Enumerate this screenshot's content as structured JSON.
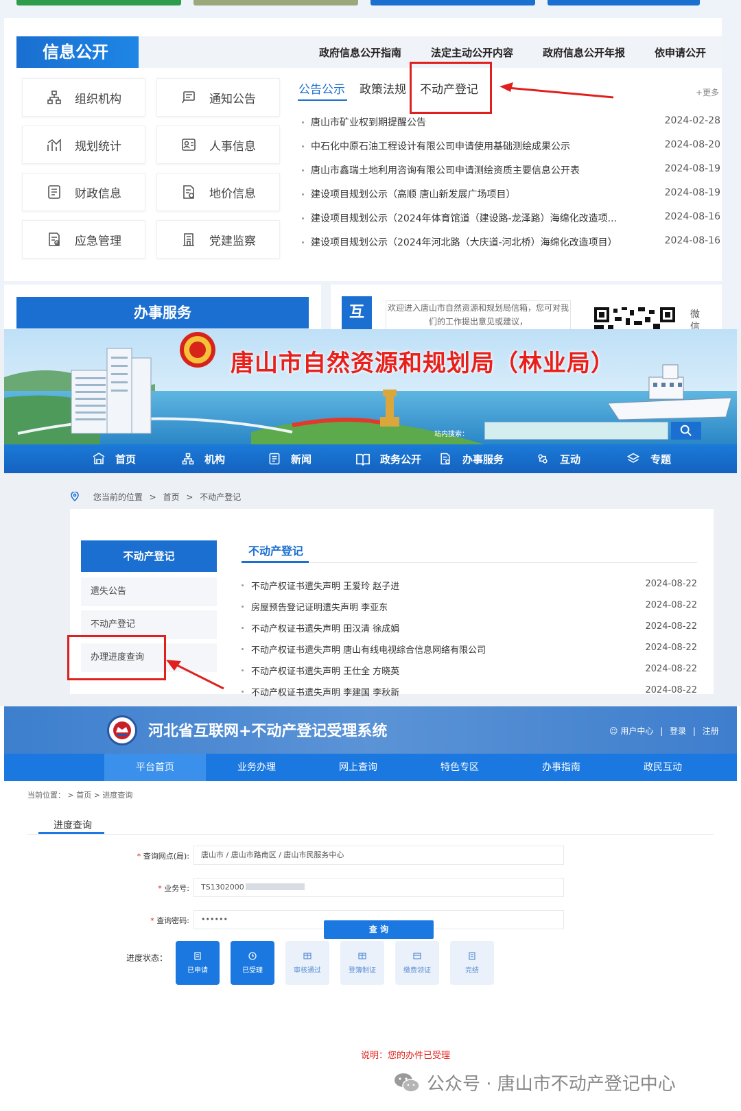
{
  "info": {
    "title": "信息公开",
    "links": [
      "政府信息公开指南",
      "法定主动公开内容",
      "政府信息公开年报",
      "依申请公开"
    ],
    "tiles": [
      {
        "label": "组织机构",
        "icon": "org-icon"
      },
      {
        "label": "通知公告",
        "icon": "notice-icon"
      },
      {
        "label": "规划统计",
        "icon": "chart-icon"
      },
      {
        "label": "人事信息",
        "icon": "personnel-icon"
      },
      {
        "label": "财政信息",
        "icon": "finance-icon"
      },
      {
        "label": "地价信息",
        "icon": "land-price-icon"
      },
      {
        "label": "应急管理",
        "icon": "emergency-icon"
      },
      {
        "label": "党建监察",
        "icon": "party-icon"
      }
    ],
    "tabs": [
      "公告公示",
      "政策法规",
      "不动产登记"
    ],
    "more": "+更多",
    "news": [
      {
        "title": "唐山市矿业权到期提醒公告",
        "date": "2024-02-28"
      },
      {
        "title": "中石化中原石油工程设计有限公司申请使用基础测绘成果公示",
        "date": "2024-08-20"
      },
      {
        "title": "唐山市鑫瑞土地利用咨询有限公司申请测绘资质主要信息公开表",
        "date": "2024-08-19"
      },
      {
        "title": "建设项目规划公示（高顺 唐山新发展广场项目）",
        "date": "2024-08-19"
      },
      {
        "title": "建设项目规划公示（2024年体育馆道（建设路-龙泽路）海绵化改造项...",
        "date": "2024-08-16"
      },
      {
        "title": "建设项目规划公示（2024年河北路（大庆道-河北桥）海绵化改造项目）",
        "date": "2024-08-16"
      }
    ],
    "service_title": "办事服务",
    "interact_label": "互",
    "welcome": "欢迎进入唐山市自然资源和规划局信箱，您可对我们的工作提出意见或建议，",
    "qr_label": "微信"
  },
  "site": {
    "title": "唐山市自然资源和规划局（林业局）",
    "search_label": "站内搜索：",
    "search_value": "",
    "nav": [
      {
        "label": "首页",
        "icon": "home-icon"
      },
      {
        "label": "机构",
        "icon": "org-icon"
      },
      {
        "label": "新闻",
        "icon": "news-icon"
      },
      {
        "label": "政务公开",
        "icon": "book-icon"
      },
      {
        "label": "办事服务",
        "icon": "service-icon"
      },
      {
        "label": "互动",
        "icon": "interact-icon"
      },
      {
        "label": "专题",
        "icon": "layers-icon"
      }
    ],
    "breadcrumb": {
      "prefix": "您当前的位置",
      "sep": ">",
      "home": "首页",
      "current": "不动产登记"
    },
    "side": {
      "title": "不动产登记",
      "items": [
        "遗失公告",
        "不动产登记",
        "办理进度查询"
      ]
    },
    "section_title": "不动产登记",
    "list": [
      {
        "title": "不动产权证书遗失声明 王爱玲 赵子进",
        "date": "2024-08-22"
      },
      {
        "title": "房屋预告登记证明遗失声明 李亚东",
        "date": "2024-08-22"
      },
      {
        "title": "不动产权证书遗失声明 田汉清 徐成娟",
        "date": "2024-08-22"
      },
      {
        "title": "不动产权证书遗失声明 唐山有线电视综合信息网络有限公司",
        "date": "2024-08-22"
      },
      {
        "title": "不动产权证书遗失声明 王仕全 方晓英",
        "date": "2024-08-22"
      },
      {
        "title": "不动产权证书遗失声明 李建国 李秋新",
        "date": "2024-08-22"
      }
    ]
  },
  "system": {
    "title": "河北省互联网+不动产登记受理系统",
    "user_center": "用户中心",
    "login": "登录",
    "register": "注册",
    "nav": [
      "平台首页",
      "业务办理",
      "网上查询",
      "特色专区",
      "办事指南",
      "政民互动"
    ],
    "breadcrumb": "当前位置： > 首页 > 进度查询",
    "tab": "进度查询",
    "fields": [
      {
        "label": "查询网点(局):",
        "value": "唐山市 / 唐山市路南区 / 唐山市民服务中心"
      },
      {
        "label": "业务号:",
        "value": "TS1302000"
      },
      {
        "label": "查询密码:",
        "value": "••••••"
      }
    ],
    "query_button": "查 询",
    "status_label": "进度状态：",
    "statuses": [
      {
        "label": "已申请",
        "active": true
      },
      {
        "label": "已受理",
        "active": true
      },
      {
        "label": "审核通过",
        "active": false
      },
      {
        "label": "登簿制证",
        "active": false
      },
      {
        "label": "缴费领证",
        "active": false
      },
      {
        "label": "完结",
        "active": false
      }
    ],
    "note": "说明：您的办件已受理"
  },
  "watermark": "公众号 · 唐山市不动产登记中心",
  "colors": {
    "primary": "#1a6fd0",
    "highlight": "#e0201c",
    "system_blue": "#1a78e0"
  }
}
